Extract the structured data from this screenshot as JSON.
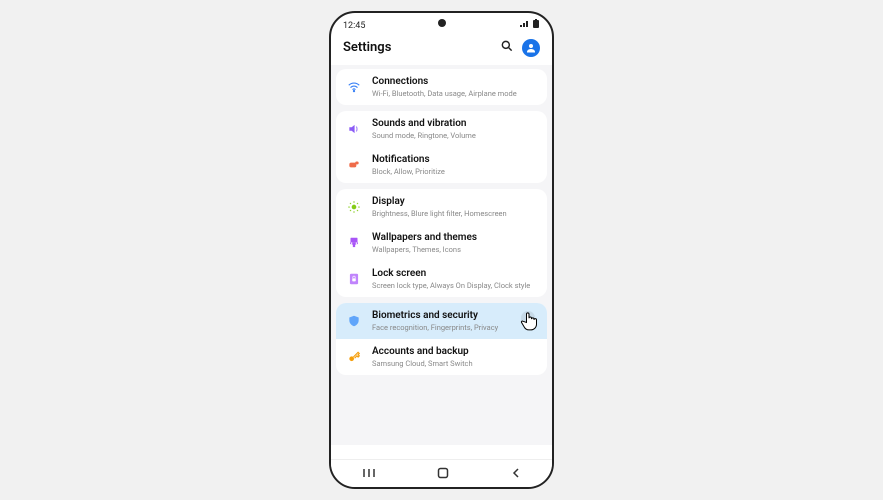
{
  "statusbar": {
    "time": "12:45"
  },
  "header": {
    "title": "Settings"
  },
  "groups": [
    {
      "items": [
        {
          "key": "connections",
          "title": "Connections",
          "sub": "Wi-Fi, Bluetooth, Data usage, Airplane mode",
          "icon": "wifi",
          "color": "#3b82f6"
        }
      ]
    },
    {
      "items": [
        {
          "key": "sounds",
          "title": "Sounds and vibration",
          "sub": "Sound mode, Ringtone, Volume",
          "icon": "sound",
          "color": "#8b5cf6"
        },
        {
          "key": "notifications",
          "title": "Notifications",
          "sub": "Block, Allow, Prioritize",
          "icon": "notif",
          "color": "#ef6c4a"
        }
      ]
    },
    {
      "items": [
        {
          "key": "display",
          "title": "Display",
          "sub": "Brightness, Blure light filter, Homescreen",
          "icon": "display",
          "color": "#84cc16"
        },
        {
          "key": "wallpapers",
          "title": "Wallpapers and themes",
          "sub": "Wallpapers, Themes, Icons",
          "icon": "brush",
          "color": "#a855f7"
        },
        {
          "key": "lockscreen",
          "title": "Lock screen",
          "sub": "Screen lock type, Always On Display, Clock style",
          "icon": "lock",
          "color": "#c084fc"
        }
      ]
    },
    {
      "items": [
        {
          "key": "biometrics",
          "title": "Biometrics and security",
          "sub": "Face recognition, Fingerprints, Privacy",
          "icon": "shield",
          "color": "#60a5fa",
          "highlight": true
        },
        {
          "key": "accounts",
          "title": "Accounts and backup",
          "sub": "Samsung Cloud, Smart Switch",
          "icon": "key",
          "color": "#f59e0b"
        }
      ]
    }
  ]
}
